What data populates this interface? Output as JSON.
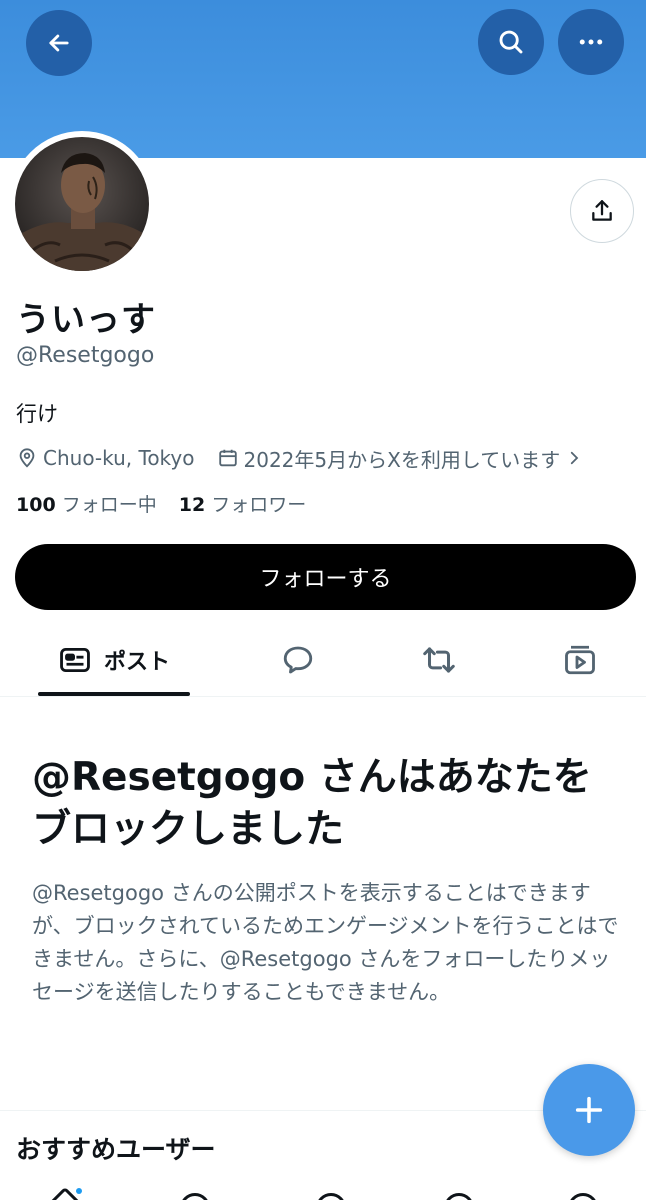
{
  "header": {
    "back_icon": "arrow-left-icon",
    "search_icon": "search-icon",
    "more_icon": "more-horizontal-icon",
    "banner_color": "#4a9be6"
  },
  "profile": {
    "display_name": "ういっす",
    "handle": "@Resetgogo",
    "bio": "行け",
    "location": "Chuo-ku, Tokyo",
    "joined": "2022年5月からXを利用しています",
    "following_count": "100",
    "following_label": "フォロー中",
    "followers_count": "12",
    "followers_label": "フォロワー",
    "follow_button": "フォローする"
  },
  "tabs": [
    {
      "label": "ポスト",
      "icon": "posts-icon",
      "active": true
    },
    {
      "label": "",
      "icon": "reply-bubble-icon",
      "active": false
    },
    {
      "label": "",
      "icon": "repost-icon",
      "active": false
    },
    {
      "label": "",
      "icon": "media-icon",
      "active": false
    }
  ],
  "blocked": {
    "title": "@Resetgogo さんはあなたをブロックしました",
    "body": "@Resetgogo さんの公開ポストを表示することはできますが、ブロックされているためエンゲージメントを行うことはできません。さらに、@Resetgogo さんをフォローしたりメッセージを送信したりすることもできません。"
  },
  "suggestions": {
    "title": "おすすめユーザー"
  },
  "fab": {
    "icon": "plus-icon"
  },
  "colors": {
    "accent": "#1d9bf0",
    "fab": "#4a99e9",
    "text_secondary": "#536471"
  }
}
